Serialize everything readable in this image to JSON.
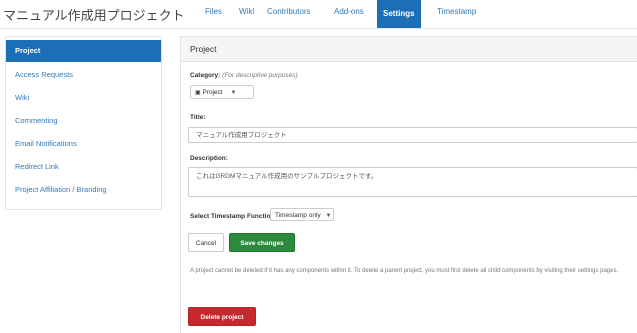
{
  "project_title": "マニュアル作成用プロジェクト",
  "nav": {
    "tabs": [
      {
        "label": "Files"
      },
      {
        "label": "Wiki"
      },
      {
        "label": "Contributors"
      },
      {
        "label": "Add-ons"
      },
      {
        "label": "Settings",
        "active": true
      },
      {
        "label": "Timestamp"
      }
    ]
  },
  "sidebar": {
    "items": [
      {
        "label": "Project",
        "active": true
      },
      {
        "label": "Access Requests"
      },
      {
        "label": "Wiki"
      },
      {
        "label": "Commenting"
      },
      {
        "label": "Email Notifications"
      },
      {
        "label": "Redirect Link"
      },
      {
        "label": "Project Affiliation / Branding"
      }
    ]
  },
  "panel": {
    "heading": "Project",
    "category": {
      "label": "Category:",
      "hint": "(For descriptive purposes)",
      "value": "Project"
    },
    "title_field": {
      "label": "Title:",
      "value": "マニュアル作成用プロジェクト"
    },
    "description_field": {
      "label": "Description:",
      "value": "これはGRDMマニュアル作成用のサンプルプロジェクトです。"
    },
    "timestamp_function": {
      "label": "Select Timestamp Function:",
      "value": "Timestamp only"
    },
    "cancel_label": "Cancel",
    "save_label": "Save changes",
    "delete_note": "A project cannot be deleted if it has any components within it. To delete a parent project, you must first delete all child components by visiting their settings pages.",
    "delete_label": "Delete project"
  },
  "colors": {
    "accent": "#1c6fb6",
    "success": "#2b8a3e",
    "danger": "#c6282e"
  }
}
